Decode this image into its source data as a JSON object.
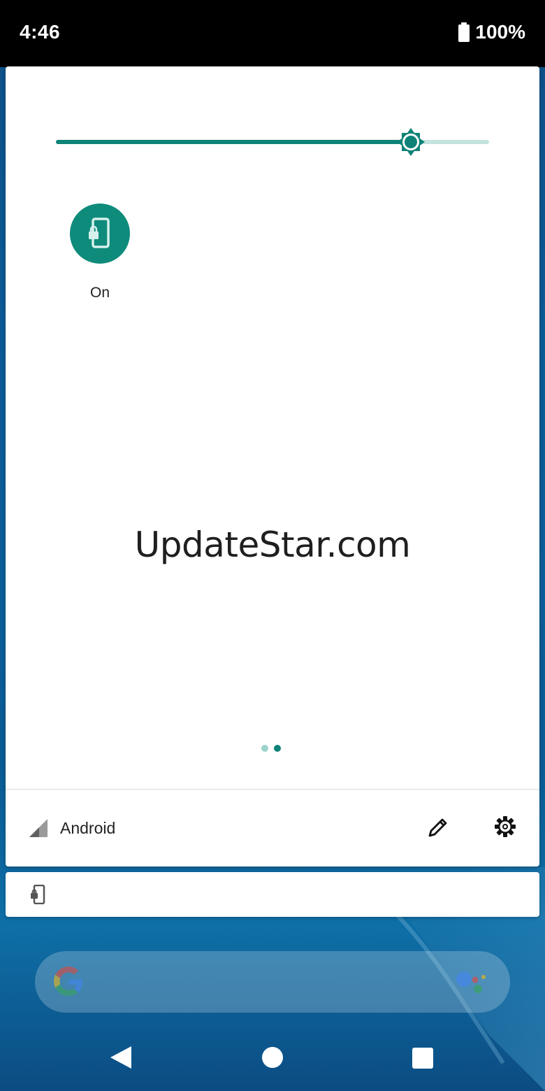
{
  "status_bar": {
    "time": "4:46",
    "battery_percent": "100%",
    "battery_icon": "battery-full-icon"
  },
  "quick_settings": {
    "brightness": {
      "level": 0.82,
      "icon": "brightness-sun-icon",
      "accent_color": "#0e8277",
      "track_color": "#c4e3df"
    },
    "tiles": [
      {
        "label": "On",
        "icon": "screen-lock-phone-icon",
        "active_color": "#0e8b7b"
      }
    ],
    "watermark": "UpdateStar.com",
    "pages": {
      "count": 2,
      "current": 2
    },
    "footer": {
      "carrier_label": "Android",
      "signal_icon": "cell-signal-icon",
      "edit_icon": "pencil-edit-icon",
      "settings_icon": "gear-icon"
    }
  },
  "notification": {
    "icon": "screen-lock-phone-icon"
  },
  "home_screen": {
    "search_icon": "google-g-icon",
    "assistant_icon": "google-assistant-icon"
  },
  "navigation": {
    "back_icon": "back-triangle-icon",
    "home_icon": "home-circle-icon",
    "recents_icon": "recents-square-icon"
  }
}
